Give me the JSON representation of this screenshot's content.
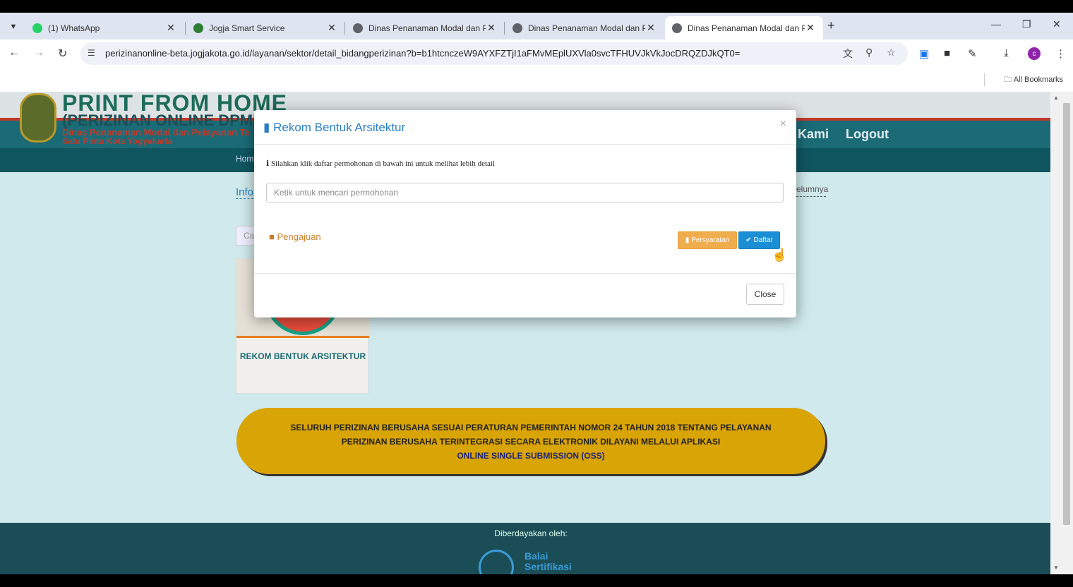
{
  "browser": {
    "tabs": [
      {
        "title": "(1) WhatsApp",
        "favicon": "whatsapp-icon",
        "color": "#25d366"
      },
      {
        "title": "Jogja Smart Service",
        "favicon": "jogja-icon",
        "color": "#2e7d32"
      },
      {
        "title": "Dinas Penanaman Modal dan P",
        "favicon": "globe-icon",
        "color": "#5f6368"
      },
      {
        "title": "Dinas Penanaman Modal dan P",
        "favicon": "globe-icon",
        "color": "#5f6368"
      },
      {
        "title": "Dinas Penanaman Modal dan P",
        "favicon": "globe-icon",
        "color": "#5f6368"
      }
    ],
    "url": "perizinanonline-beta.jogjakota.go.id/layanan/sektor/detail_bidangperizinan?b=b1htcnczeW9AYXFZTjI1aFMvMEplUXVla0svcTFHUVJkVkJocDRQZDJkQT0=",
    "bookmarks_label": "All Bookmarks",
    "profile_initial": "c"
  },
  "site": {
    "header_title": "PRINT FROM HOME",
    "header_subtitle": "(PERIZINAN ONLINE DPMPTS",
    "header_line3": "Dinas Penanaman Modal dan Pelayanan Te",
    "header_line4": "Satu Pintu Kota Yogyakarta",
    "menu_kami": "Kami",
    "menu_logout": "Logout",
    "subnav_home": "Hom",
    "info_label": "Info",
    "right_link": "elumnya",
    "search_ghost": "Ca",
    "card_title": "REKOM BENTUK ARSITEKTUR",
    "banner_line1": "SELURUH PERIZINAN BERUSAHA SESUAI PERATURAN PEMERINTAH NOMOR 24 TAHUN 2018 TENTANG PELAYANAN",
    "banner_line2": "PERIZINAN BERUSAHA TERINTEGRASI SECARA ELEKTRONIK DILAYANI MELALUI APLIKASI",
    "banner_line3": "ONLINE SINGLE SUBMISSION (OSS)",
    "footer_powered": "Diberdayakan oleh:",
    "footer_logo_line1": "Balai",
    "footer_logo_line2": "Sertifikasi"
  },
  "modal": {
    "title": "Rekom Bentuk Arsitektur",
    "info": "Silahkan klik daftar permohonan di bawah ini untuk melihat lebih detail",
    "search_placeholder": "Ketik untuk mencari permohonan",
    "section_label": "Pengajuan",
    "btn_persyaratan": "Persyaratan",
    "btn_daftar": "Daftar",
    "btn_close": "Close"
  }
}
